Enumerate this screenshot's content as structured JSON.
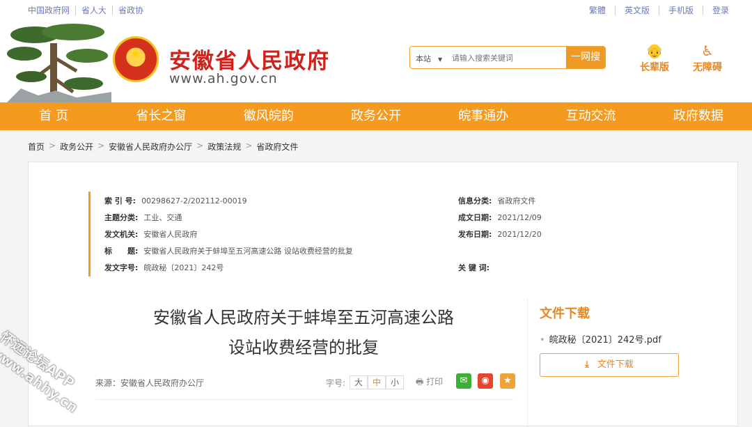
{
  "topbar": {
    "left_links": [
      "中国政府网",
      "省人大",
      "省政协"
    ],
    "right_links": [
      "繁體",
      "英文版",
      "手机版",
      "登录"
    ]
  },
  "header": {
    "site_title": "安徽省人民政府",
    "site_url": "www.ah.gov.cn",
    "search": {
      "scope": "本站",
      "placeholder": "请输入搜索关键词",
      "button": "一网搜"
    },
    "elder_mode": "长辈版",
    "accessibility": "无障碍"
  },
  "nav": [
    "首 页",
    "省长之窗",
    "徽风皖韵",
    "政务公开",
    "皖事通办",
    "互动交流",
    "政府数据"
  ],
  "breadcrumb": [
    "首页",
    "政务公开",
    "安徽省人民政府办公厅",
    "政策法规",
    "省政府文件"
  ],
  "meta": {
    "index_label": "索 引 号:",
    "index_value": "00298627-2/202112-00019",
    "category_label": "信息分类:",
    "category_value": "省政府文件",
    "topic_label": "主题分类:",
    "topic_value": "工业、交通",
    "created_label": "成文日期:",
    "created_value": "2021/12/09",
    "issuer_label": "发文机关:",
    "issuer_value": "安徽省人民政府",
    "published_label": "发布日期:",
    "published_value": "2021/12/20",
    "title_label": "标　　题:",
    "title_value": "安徽省人民政府关于蚌埠至五河高速公路 设站收费经营的批复",
    "docno_label": "发文字号:",
    "docno_value": "皖政秘〔2021〕242号",
    "keywords_label": "关 键 词:",
    "keywords_value": ""
  },
  "document": {
    "title_line1": "安徽省人民政府关于蚌埠至五河高速公路",
    "title_line2": "设站收费经营的批复",
    "source": "来源：安徽省人民政府办公厅",
    "font_size_label": "字号:",
    "font_sizes": [
      "大",
      "中",
      "小"
    ],
    "print_label": "打印"
  },
  "download": {
    "title": "文件下载",
    "file_name": "皖政秘〔2021〕242号.pdf",
    "button": "文件下载"
  },
  "watermark": {
    "line1": "怀远论坛APP",
    "line2": "www.ahhy.cn"
  },
  "colors": {
    "accent": "#f39a1f",
    "title_red": "#d0221c",
    "wechat": "#3cb034",
    "weibo": "#e8452c",
    "star": "#f0a23a"
  }
}
